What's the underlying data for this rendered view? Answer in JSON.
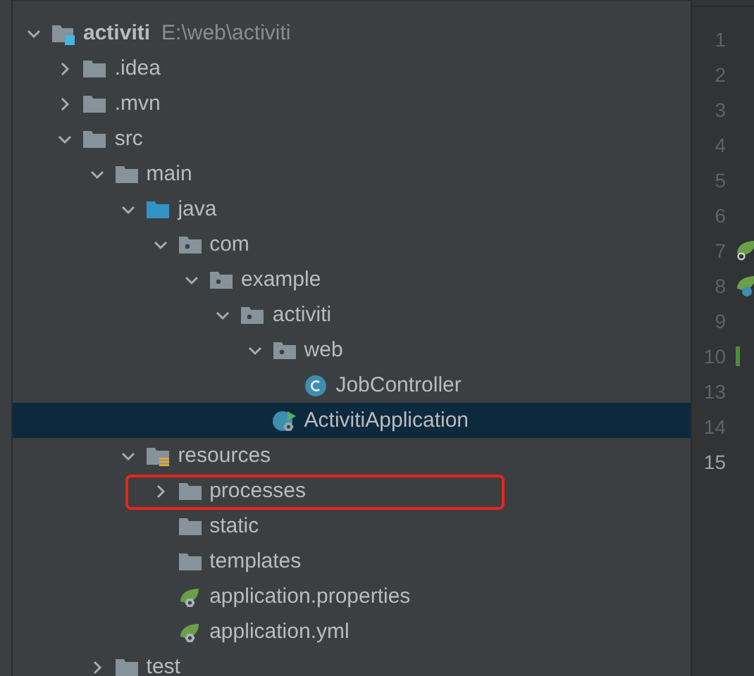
{
  "tree": [
    {
      "name": "activiti",
      "path": "E:\\web\\activiti",
      "kind": "project",
      "expanded": true,
      "selected": false,
      "highlighted": false,
      "children": [
        {
          "name": ".idea",
          "kind": "folder",
          "expanded": false,
          "selected": false,
          "highlighted": false
        },
        {
          "name": ".mvn",
          "kind": "folder",
          "expanded": false,
          "selected": false,
          "highlighted": false
        },
        {
          "name": "src",
          "kind": "folder",
          "expanded": true,
          "selected": false,
          "highlighted": false,
          "children": [
            {
              "name": "main",
              "kind": "folder",
              "expanded": true,
              "selected": false,
              "highlighted": false,
              "children": [
                {
                  "name": "java",
                  "kind": "source",
                  "expanded": true,
                  "selected": false,
                  "highlighted": false,
                  "children": [
                    {
                      "name": "com",
                      "kind": "package",
                      "expanded": true,
                      "selected": false,
                      "highlighted": false,
                      "children": [
                        {
                          "name": "example",
                          "kind": "package",
                          "expanded": true,
                          "selected": false,
                          "highlighted": false,
                          "children": [
                            {
                              "name": "activiti",
                              "kind": "package",
                              "expanded": true,
                              "selected": false,
                              "highlighted": false,
                              "children": [
                                {
                                  "name": "web",
                                  "kind": "package",
                                  "expanded": true,
                                  "selected": false,
                                  "highlighted": false,
                                  "children": [
                                    {
                                      "name": "JobController",
                                      "kind": "class",
                                      "selected": false,
                                      "highlighted": false
                                    }
                                  ]
                                },
                                {
                                  "name": "ActivitiApplication",
                                  "kind": "app",
                                  "selected": true,
                                  "highlighted": false
                                }
                              ]
                            }
                          ]
                        }
                      ]
                    }
                  ]
                },
                {
                  "name": "resources",
                  "kind": "resources",
                  "expanded": true,
                  "selected": false,
                  "highlighted": false,
                  "children": [
                    {
                      "name": "processes",
                      "kind": "folder",
                      "expanded": false,
                      "selected": false,
                      "highlighted": true
                    },
                    {
                      "name": "static",
                      "kind": "folder",
                      "selected": false,
                      "highlighted": false
                    },
                    {
                      "name": "templates",
                      "kind": "folder",
                      "selected": false,
                      "highlighted": false
                    },
                    {
                      "name": "application.properties",
                      "kind": "config",
                      "selected": false,
                      "highlighted": false
                    },
                    {
                      "name": "application.yml",
                      "kind": "config",
                      "selected": false,
                      "highlighted": false
                    }
                  ]
                }
              ]
            },
            {
              "name": "test",
              "kind": "folder",
              "expanded": false,
              "selected": false,
              "highlighted": false
            }
          ]
        }
      ]
    }
  ],
  "gutter": [
    {
      "number": "1",
      "current": false
    },
    {
      "number": "2",
      "current": false
    },
    {
      "number": "3",
      "current": false
    },
    {
      "number": "4",
      "current": false
    },
    {
      "number": "5",
      "current": false
    },
    {
      "number": "6",
      "current": false
    },
    {
      "number": "7",
      "current": false,
      "kind": "bean"
    },
    {
      "number": "8",
      "current": false,
      "kind": "app"
    },
    {
      "number": "9",
      "current": false
    },
    {
      "number": "10",
      "current": false,
      "kind": "change"
    },
    {
      "number": "13",
      "current": false
    },
    {
      "number": "14",
      "current": false
    },
    {
      "number": "15",
      "current": true
    }
  ]
}
